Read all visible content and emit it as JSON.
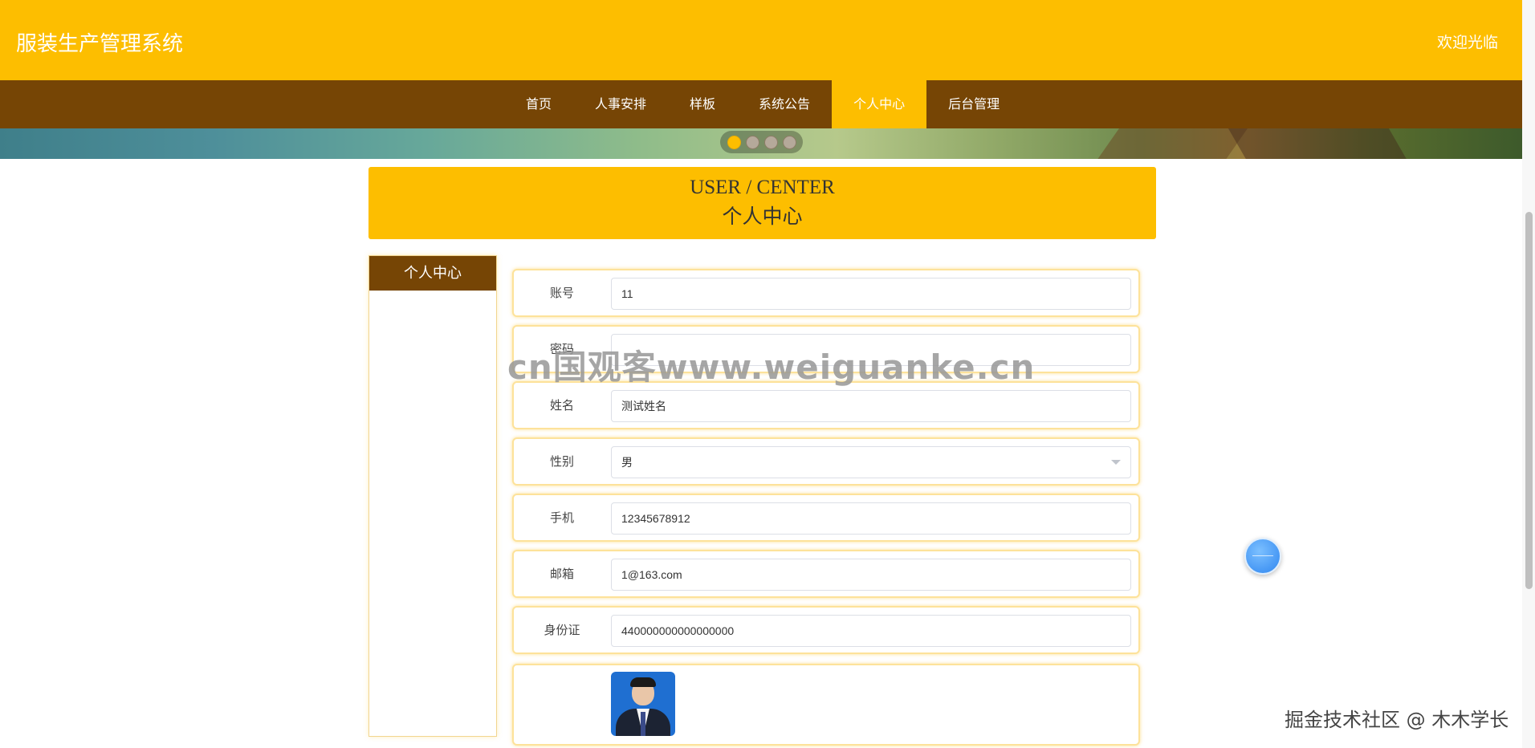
{
  "header": {
    "site_title": "服装生产管理系统",
    "welcome": "欢迎光临"
  },
  "nav": {
    "items": [
      {
        "label": "首页"
      },
      {
        "label": "人事安排"
      },
      {
        "label": "样板"
      },
      {
        "label": "系统公告"
      },
      {
        "label": "个人中心",
        "active": true
      },
      {
        "label": "后台管理"
      }
    ]
  },
  "carousel": {
    "dot_count": 4,
    "active_index": 0
  },
  "center_header": {
    "title_en": "USER / CENTER",
    "title_cn": "个人中心"
  },
  "sidebar": {
    "title": "个人中心"
  },
  "form": {
    "fields": [
      {
        "label": "账号",
        "value": "11"
      },
      {
        "label": "密码",
        "value": ""
      },
      {
        "label": "姓名",
        "value": "测试姓名"
      },
      {
        "label": "性别",
        "value": "男"
      },
      {
        "label": "手机",
        "value": "12345678912"
      },
      {
        "label": "邮箱",
        "value": "1@163.com"
      },
      {
        "label": "身份证",
        "value": "440000000000000000"
      }
    ]
  },
  "watermark": "cn国观客www.weiguanke.cn",
  "bottom_watermark": "掘金技术社区 @ 木木学长",
  "colors": {
    "primary": "#fdbe00",
    "nav_brown": "#764505",
    "row_border": "#fde29a",
    "float_button": "#2f86f0"
  }
}
